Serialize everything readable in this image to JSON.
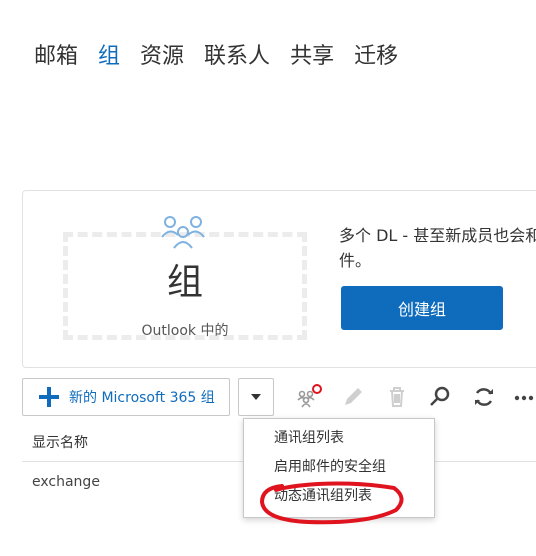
{
  "nav": {
    "items": [
      {
        "label": "邮箱",
        "active": false
      },
      {
        "label": "组",
        "active": true
      },
      {
        "label": "资源",
        "active": false
      },
      {
        "label": "联系人",
        "active": false
      },
      {
        "label": "共享",
        "active": false
      },
      {
        "label": "迁移",
        "active": false
      }
    ]
  },
  "promo": {
    "title": "组",
    "subtitle": "Outlook 中的",
    "description": "多个 DL - 甚至新成员也会和附件。",
    "create_label": "创建组",
    "icon": "people-group-icon"
  },
  "toolbar": {
    "new_label": "新的 Microsoft 365 组",
    "dropdown_icon": "chevron-down-icon",
    "icons": [
      "group-settings-icon",
      "edit-icon",
      "delete-icon",
      "search-icon",
      "refresh-icon",
      "more-icon"
    ]
  },
  "list": {
    "column_header": "显示名称",
    "rows": [
      "exchange"
    ]
  },
  "menu": {
    "items": [
      "通讯组列表",
      "启用邮件的安全组",
      "动态通讯组列表"
    ],
    "highlighted_item": "动态通讯组列表"
  },
  "colors": {
    "accent": "#0f6cbd",
    "annotation": "#e0141e",
    "text": "#333333"
  }
}
